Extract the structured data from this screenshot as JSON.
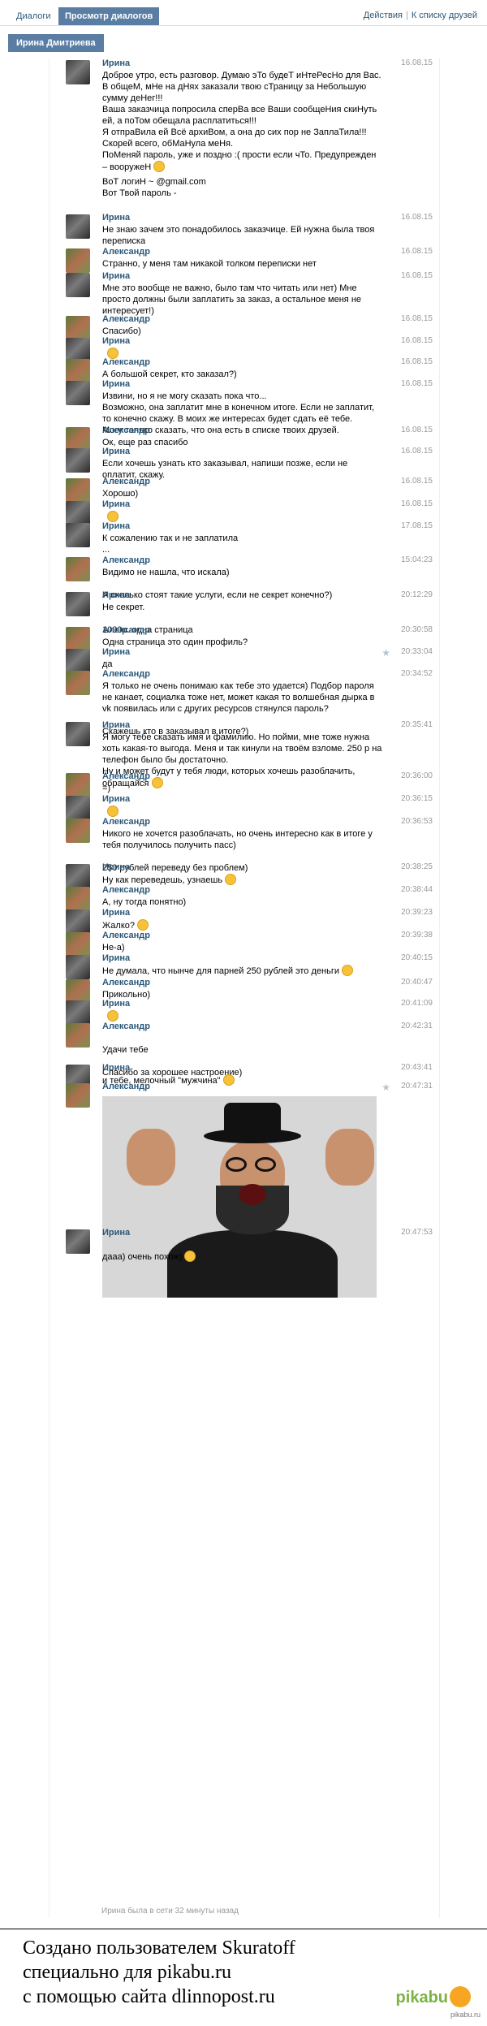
{
  "header": {
    "tab_dialogs": "Диалоги",
    "tab_view": "Просмотр диалогов",
    "link_actions": "Действия",
    "separator": "|",
    "link_back": "К списку друзей"
  },
  "person_chip": "Ирина Дмитриева",
  "messages": [
    {
      "name": "Ирина",
      "time": "16.08.15",
      "lines": [
        "Доброе утро, есть разговор. Думаю эТо будеТ иНтеРесНо для Вас. В общеМ, мНе на дНях заказали твою сТраницу за Небольшую сумму деНег!!!",
        "Ваша заказчица попросила сперВа все Ваши сообщеНия скиНуть ей, а поТом обещала расплатиться!!!",
        "Я отпраВила ей Всё архиВом, а она до сих пор не ЗаплаТила!!! Скорей всего, обМаНула меНя.",
        "ПоМеняй пароль, уже и поздно :( прости если чТо. Предупрежден – вооружеН"
      ]
    },
    {
      "name": "",
      "time": "",
      "lines": [
        "ВоТ логиН ~            @gmail.com",
        "Вот Твой пароль -"
      ]
    },
    {
      "name": "Ирина",
      "time": "16.08.15",
      "lines": [
        "Не знаю зачем это понадобилось заказчице. Ей нужна была твоя переписка"
      ]
    },
    {
      "name": "Александр",
      "time": "16.08.15",
      "lines": [
        "Странно, у меня там никакой толком переписки нет"
      ]
    },
    {
      "name": "Ирина",
      "time": "16.08.15",
      "lines": [
        "Мне это вообще не важно, было там что читать или нет) Мне просто должны были заплатить за заказ, а остальное меня не интересует!)"
      ]
    },
    {
      "name": "Александр",
      "time": "16.08.15",
      "lines": [
        "Спасибо)"
      ]
    },
    {
      "name": "Ирина",
      "time": "16.08.15",
      "lines": [
        ""
      ]
    },
    {
      "name": "Александр",
      "time": "16.08.15",
      "lines": [
        "А большой секрет, кто заказал?)"
      ]
    },
    {
      "name": "Ирина",
      "time": "16.08.15",
      "lines": [
        "Извини, но я не могу сказать пока что...",
        "Возможно, она заплатит мне в конечном итоге. Если не заплатит, то конечно скажу. В моих же интересах будет сдать её тебе.",
        "Могу только сказать, что она есть в списке твоих друзей."
      ]
    },
    {
      "name": "Александр",
      "time": "16.08.15",
      "lines": [
        "Ок, еще раз спасибо"
      ]
    },
    {
      "name": "Ирина",
      "time": "16.08.15",
      "lines": [
        "Если хочешь узнать кто заказывал, напиши позже, если не оплатит, скажу."
      ]
    },
    {
      "name": "Александр",
      "time": "16.08.15",
      "lines": [
        "Хорошо)"
      ]
    },
    {
      "name": "Ирина",
      "time": "16.08.15",
      "lines": [
        ""
      ]
    },
    {
      "name": "Ирина",
      "time": "17.08.15",
      "lines": [
        "К сожалению так и не заплатила",
        "..."
      ]
    },
    {
      "name": "Александр",
      "time": "15:04:23",
      "lines": [
        "Видимо не нашла, что искала)",
        "",
        "А сколько стоят такие услуги, если не секрет конечно?)"
      ]
    },
    {
      "name": "Ирина",
      "time": "20:12:29",
      "lines": [
        "Не секрет.",
        "",
        "1000р. одна страница"
      ]
    },
    {
      "name": "Александр",
      "time": "20:30:58",
      "lines": [
        "Одна страница это один профиль?"
      ]
    },
    {
      "name": "Ирина",
      "time": "20:33:04",
      "lines": [
        "да"
      ]
    },
    {
      "name": "Александр",
      "time": "20:34:52",
      "lines": [
        "Я только не очень понимаю как тебе это удается) Подбор пароля не канает, социалка тоже нет, может какая то волшебная дырка в vk появилась или с других ресурсов стянулся пароль?",
        "",
        "Скажешь кто в заказывал в итоге?)"
      ]
    },
    {
      "name": "Ирина",
      "time": "20:35:41",
      "lines": [
        "Я могу тебе сказать имя и фамилию. Но пойми, мне тоже нужна хоть какая-то выгода. Меня и так кинули на твоём взломе. 250 р на телефон было бы достаточно.",
        "Ну и может будут у тебя люди, которых хочешь разоблачить, обращайся"
      ]
    },
    {
      "name": "Александр",
      "time": "20:36:00",
      "lines": [
        "=)"
      ]
    },
    {
      "name": "Ирина",
      "time": "20:36:15",
      "lines": [
        ""
      ]
    },
    {
      "name": "Александр",
      "time": "20:36:53",
      "lines": [
        "Никого не хочется разоблачать, но очень интересно как в итоге у тебя получилось получить пасс)",
        "",
        "250 рублей переведу без проблем)"
      ]
    },
    {
      "name": "Ирина",
      "time": "20:38:25",
      "lines": [
        "Ну как переведешь, узнаешь"
      ]
    },
    {
      "name": "Александр",
      "time": "20:38:44",
      "lines": [
        "А, ну тогда понятно)"
      ]
    },
    {
      "name": "Ирина",
      "time": "20:39:23",
      "lines": [
        "Жалко?"
      ]
    },
    {
      "name": "Александр",
      "time": "20:39:38",
      "lines": [
        "Не-а)"
      ]
    },
    {
      "name": "Ирина",
      "time": "20:40:15",
      "lines": [
        "Не думала, что нынче для парней 250 рублей это деньги"
      ]
    },
    {
      "name": "Александр",
      "time": "20:40:47",
      "lines": [
        "Прикольно)"
      ]
    },
    {
      "name": "Ирина",
      "time": "20:41:09",
      "lines": [
        ""
      ]
    },
    {
      "name": "Александр",
      "time": "20:42:31",
      "lines": [
        "",
        "Удачи тебе",
        "",
        "Спасибо за хорошее настроение)"
      ]
    },
    {
      "name": "Ирина",
      "time": "20:43:41",
      "lines": [
        " и тебе, мелочный \"мужчина\""
      ]
    },
    {
      "name": "Александр",
      "time": "20:47:31",
      "lines": []
    },
    {
      "name": "Ирина",
      "time": "20:47:53",
      "lines": [
        "",
        "дааа) очень похож)"
      ]
    }
  ],
  "online_status": "Ирина была в сети 32 минуты назад",
  "footer": {
    "line1": "Создано пользователем Skuratoff",
    "line2": "специально для pikabu.ru",
    "line3": "с помощью сайта dlinnopost.ru",
    "logo": "pikabu",
    "small": "pikabu.ru"
  }
}
